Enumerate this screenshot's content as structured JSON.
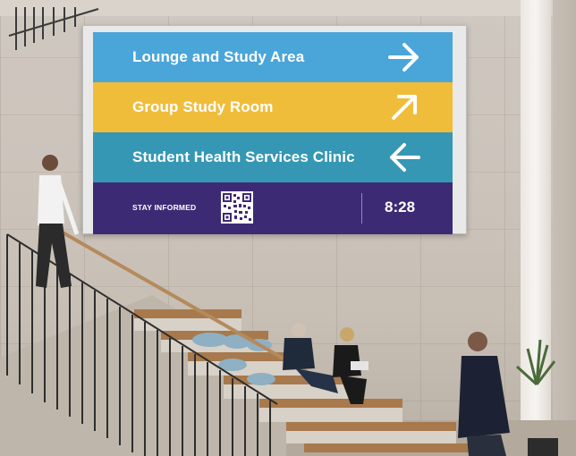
{
  "sign": {
    "rows": [
      {
        "label": "Lounge and Study Area",
        "arrow": "arrow-right-icon",
        "color": "#4aa5d9"
      },
      {
        "label": "Group Study Room",
        "arrow": "arrow-up-right-icon",
        "color": "#f0bd3b"
      },
      {
        "label": "Student Health Services Clinic",
        "arrow": "arrow-left-icon",
        "color": "#3597b4"
      }
    ],
    "footer": {
      "stay_informed": "STAY INFORMED",
      "qr": "qr-code-icon",
      "time": "8:28",
      "color": "#3d2a74"
    }
  }
}
